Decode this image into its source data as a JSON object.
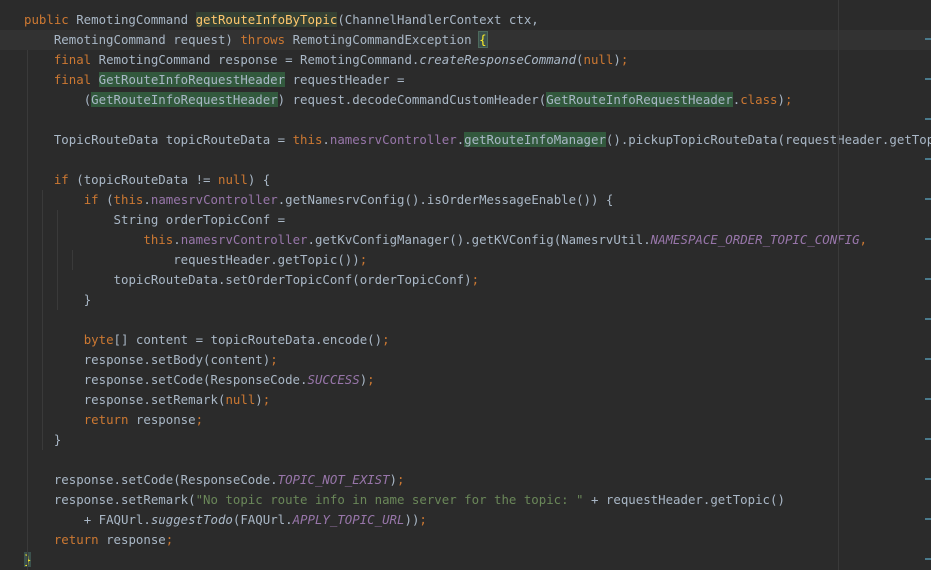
{
  "editor": {
    "language": "java",
    "current_line": 1,
    "colors": {
      "background": "#2b2b2b",
      "text": "#a9b7c6",
      "keyword": "#cc7832",
      "field": "#9876aa",
      "string": "#6a8759",
      "method_declaration": "#ffc66d",
      "usage_highlight": "#32593d"
    },
    "lines": [
      {
        "indent": 0,
        "tokens": [
          {
            "text": "public ",
            "cls": "kw"
          },
          {
            "text": "RemotingCommand ",
            "cls": ""
          },
          {
            "text": "getRouteInfoByTopic",
            "cls": "hl-gold"
          },
          {
            "text": "(ChannelHandlerContext ctx,",
            "cls": ""
          }
        ]
      },
      {
        "indent": 2,
        "tokens": [
          {
            "text": "RemotingCommand request) ",
            "cls": ""
          },
          {
            "text": "throws ",
            "cls": "kw"
          },
          {
            "text": "RemotingCommandException ",
            "cls": ""
          },
          {
            "text": "{",
            "cls": "brace-match"
          }
        ]
      },
      {
        "indent": 2,
        "tokens": [
          {
            "text": "final ",
            "cls": "kw"
          },
          {
            "text": "RemotingCommand response = RemotingCommand.",
            "cls": ""
          },
          {
            "text": "createResponseCommand",
            "cls": "smeth"
          },
          {
            "text": "(",
            "cls": ""
          },
          {
            "text": "null",
            "cls": "kw"
          },
          {
            "text": ")",
            "cls": ""
          },
          {
            "text": ";",
            "cls": "kw"
          }
        ]
      },
      {
        "indent": 2,
        "tokens": [
          {
            "text": "final ",
            "cls": "kw"
          },
          {
            "text": "GetRouteInfoRequestHeader",
            "cls": "hl"
          },
          {
            "text": " requestHeader =",
            "cls": ""
          }
        ]
      },
      {
        "indent": 4,
        "tokens": [
          {
            "text": "(",
            "cls": ""
          },
          {
            "text": "GetRouteInfoRequestHeader",
            "cls": "hl"
          },
          {
            "text": ") request.decodeCommandCustomHeader(",
            "cls": ""
          },
          {
            "text": "GetRouteInfoRequestHeader",
            "cls": "hl"
          },
          {
            "text": ".",
            "cls": ""
          },
          {
            "text": "class",
            "cls": "kw"
          },
          {
            "text": ")",
            "cls": ""
          },
          {
            "text": ";",
            "cls": "kw"
          }
        ]
      },
      {
        "indent": 0,
        "tokens": []
      },
      {
        "indent": 2,
        "tokens": [
          {
            "text": "TopicRouteData topicRouteData = ",
            "cls": ""
          },
          {
            "text": "this",
            "cls": "kw"
          },
          {
            "text": ".",
            "cls": ""
          },
          {
            "text": "namesrvController",
            "cls": "fld"
          },
          {
            "text": ".",
            "cls": ""
          },
          {
            "text": "getRouteInfoManager",
            "cls": "hl"
          },
          {
            "text": "().pickupTopicRouteData(requestHeader.getTopic())",
            "cls": ""
          },
          {
            "text": ";",
            "cls": "kw"
          }
        ]
      },
      {
        "indent": 0,
        "tokens": []
      },
      {
        "indent": 2,
        "tokens": [
          {
            "text": "if ",
            "cls": "kw"
          },
          {
            "text": "(topicRouteData != ",
            "cls": ""
          },
          {
            "text": "null",
            "cls": "kw"
          },
          {
            "text": ") {",
            "cls": ""
          }
        ]
      },
      {
        "indent": 4,
        "tokens": [
          {
            "text": "if ",
            "cls": "kw"
          },
          {
            "text": "(",
            "cls": ""
          },
          {
            "text": "this",
            "cls": "kw"
          },
          {
            "text": ".",
            "cls": ""
          },
          {
            "text": "namesrvController",
            "cls": "fld"
          },
          {
            "text": ".getNamesrvConfig().isOrderMessageEnable()) {",
            "cls": ""
          }
        ]
      },
      {
        "indent": 6,
        "tokens": [
          {
            "text": "String orderTopicConf =",
            "cls": ""
          }
        ]
      },
      {
        "indent": 8,
        "tokens": [
          {
            "text": "this",
            "cls": "kw"
          },
          {
            "text": ".",
            "cls": ""
          },
          {
            "text": "namesrvController",
            "cls": "fld"
          },
          {
            "text": ".getKvConfigManager().getKVConfig(NamesrvUtil.",
            "cls": ""
          },
          {
            "text": "NAMESPACE_ORDER_TOPIC_CONFIG",
            "cls": "const"
          },
          {
            "text": ",",
            "cls": "kw"
          }
        ]
      },
      {
        "indent": 10,
        "tokens": [
          {
            "text": "requestHeader.getTopic())",
            "cls": ""
          },
          {
            "text": ";",
            "cls": "kw"
          }
        ]
      },
      {
        "indent": 6,
        "tokens": [
          {
            "text": "topicRouteData.setOrderTopicConf(orderTopicConf)",
            "cls": ""
          },
          {
            "text": ";",
            "cls": "kw"
          }
        ]
      },
      {
        "indent": 4,
        "tokens": [
          {
            "text": "}",
            "cls": ""
          }
        ]
      },
      {
        "indent": 0,
        "tokens": []
      },
      {
        "indent": 4,
        "tokens": [
          {
            "text": "byte",
            "cls": "kw"
          },
          {
            "text": "[] content = topicRouteData.encode()",
            "cls": ""
          },
          {
            "text": ";",
            "cls": "kw"
          }
        ]
      },
      {
        "indent": 4,
        "tokens": [
          {
            "text": "response.setBody(content)",
            "cls": ""
          },
          {
            "text": ";",
            "cls": "kw"
          }
        ]
      },
      {
        "indent": 4,
        "tokens": [
          {
            "text": "response.setCode(ResponseCode.",
            "cls": ""
          },
          {
            "text": "SUCCESS",
            "cls": "const"
          },
          {
            "text": ")",
            "cls": ""
          },
          {
            "text": ";",
            "cls": "kw"
          }
        ]
      },
      {
        "indent": 4,
        "tokens": [
          {
            "text": "response.setRemark(",
            "cls": ""
          },
          {
            "text": "null",
            "cls": "kw"
          },
          {
            "text": ")",
            "cls": ""
          },
          {
            "text": ";",
            "cls": "kw"
          }
        ]
      },
      {
        "indent": 4,
        "tokens": [
          {
            "text": "return ",
            "cls": "kw"
          },
          {
            "text": "response",
            "cls": ""
          },
          {
            "text": ";",
            "cls": "kw"
          }
        ]
      },
      {
        "indent": 2,
        "tokens": [
          {
            "text": "}",
            "cls": ""
          }
        ]
      },
      {
        "indent": 0,
        "tokens": []
      },
      {
        "indent": 2,
        "tokens": [
          {
            "text": "response.setCode(ResponseCode.",
            "cls": ""
          },
          {
            "text": "TOPIC_NOT_EXIST",
            "cls": "const"
          },
          {
            "text": ")",
            "cls": ""
          },
          {
            "text": ";",
            "cls": "kw"
          }
        ]
      },
      {
        "indent": 2,
        "tokens": [
          {
            "text": "response.setRemark(",
            "cls": ""
          },
          {
            "text": "\"No topic route info in name server for the topic: \"",
            "cls": "str"
          },
          {
            "text": " + requestHeader.getTopic()",
            "cls": ""
          }
        ]
      },
      {
        "indent": 4,
        "tokens": [
          {
            "text": "+ FAQUrl.",
            "cls": ""
          },
          {
            "text": "suggestTodo",
            "cls": "smeth"
          },
          {
            "text": "(FAQUrl.",
            "cls": ""
          },
          {
            "text": "APPLY_TOPIC_URL",
            "cls": "const"
          },
          {
            "text": "))",
            "cls": ""
          },
          {
            "text": ";",
            "cls": "kw"
          }
        ]
      },
      {
        "indent": 2,
        "tokens": [
          {
            "text": "return ",
            "cls": "kw"
          },
          {
            "text": "response",
            "cls": ""
          },
          {
            "text": ";",
            "cls": "kw"
          }
        ]
      },
      {
        "indent": 0,
        "tokens": [
          {
            "text": "}",
            "cls": "brace-end"
          }
        ]
      }
    ]
  }
}
